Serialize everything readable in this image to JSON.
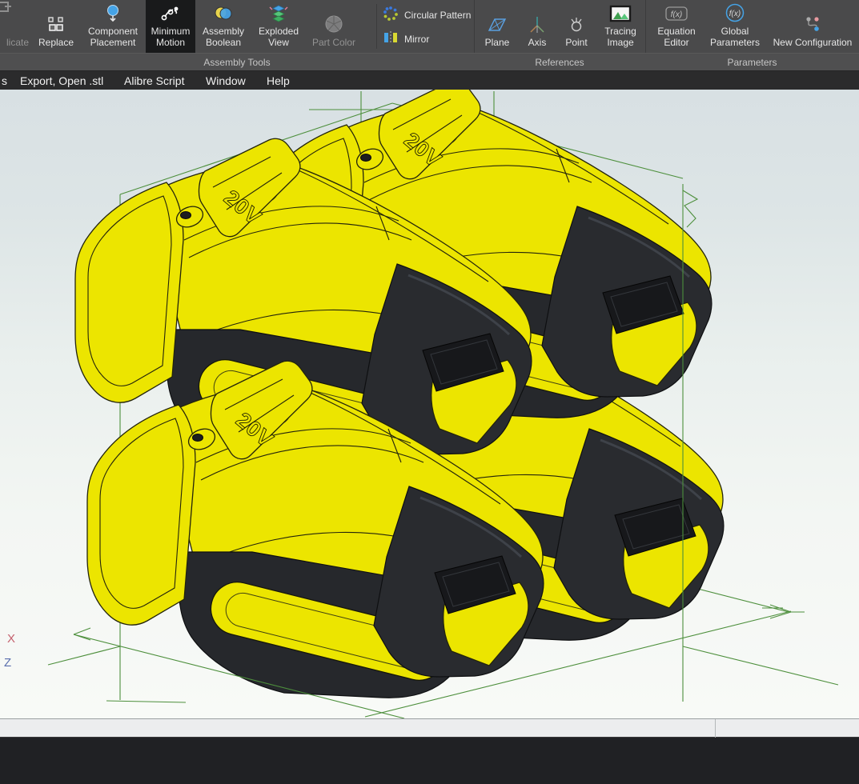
{
  "ribbon": {
    "groups": [
      {
        "label": "Assembly Tools",
        "buttons": [
          {
            "label": "licate",
            "state": "disabled"
          },
          {
            "label": "Replace",
            "state": "normal"
          },
          {
            "label": "Component Placement",
            "state": "normal"
          },
          {
            "label": "Minimum Motion",
            "state": "active"
          },
          {
            "label": "Assembly Boolean",
            "state": "normal"
          },
          {
            "label": "Exploded View",
            "state": "normal"
          },
          {
            "label": "Part Color",
            "state": "disabled"
          },
          {
            "label": "Circular Pattern",
            "state": "normal"
          },
          {
            "label": "Mirror",
            "state": "normal"
          }
        ]
      },
      {
        "label": "References",
        "buttons": [
          {
            "label": "Plane"
          },
          {
            "label": "Axis"
          },
          {
            "label": "Point"
          },
          {
            "label": "Tracing Image"
          }
        ]
      },
      {
        "label": "Parameters",
        "buttons": [
          {
            "label": "Equation Editor"
          },
          {
            "label": "Global Parameters"
          },
          {
            "label": "New Configuration"
          }
        ]
      }
    ],
    "icon_glyphs": {
      "fx": "f(x)"
    }
  },
  "menubar": {
    "items": [
      {
        "label": "s"
      },
      {
        "label": "Export, Open .stl"
      },
      {
        "label": "Alibre Script"
      },
      {
        "label": "Window"
      },
      {
        "label": "Help"
      }
    ]
  },
  "viewport": {
    "badge": "20V",
    "axis_triad": {
      "x": "X",
      "z": "Z"
    },
    "colors": {
      "body_yellow": "#ece500",
      "body_dark": "#27292d",
      "wireframe_green": "#4d8f3c",
      "bg_top": "#d8e0e3",
      "bg_bottom": "#f8faf7"
    }
  }
}
